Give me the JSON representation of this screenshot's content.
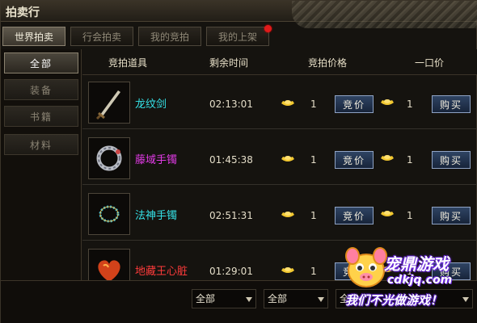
{
  "window": {
    "title": "拍卖行"
  },
  "tabs": [
    {
      "label": "世界拍卖",
      "active": true
    },
    {
      "label": "行会拍卖",
      "active": false
    },
    {
      "label": "我的竞拍",
      "active": false
    },
    {
      "label": "我的上架",
      "active": false,
      "notification": true
    }
  ],
  "categories": [
    {
      "label": "全部",
      "active": true
    },
    {
      "label": "装备",
      "active": false
    },
    {
      "label": "书籍",
      "active": false
    },
    {
      "label": "材料",
      "active": false
    }
  ],
  "table": {
    "headers": {
      "item": "竞拍道具",
      "time": "剩余时间",
      "bid_price": "竞拍价格",
      "buyout": "一口价"
    },
    "rows": [
      {
        "name": "龙纹剑",
        "name_color": "#35e3e8",
        "icon": "sword-icon",
        "time": "02:13:01",
        "bid": "1",
        "bid_button": "竞价",
        "buyout": "1",
        "buy_button": "购买"
      },
      {
        "name": "藤域手镯",
        "name_color": "#e23be6",
        "icon": "bracelet-icon",
        "time": "01:45:38",
        "bid": "1",
        "bid_button": "竞价",
        "buyout": "1",
        "buy_button": "购买"
      },
      {
        "name": "法神手镯",
        "name_color": "#35e3e8",
        "icon": "bead-bracelet-icon",
        "time": "02:51:31",
        "bid": "1",
        "bid_button": "竞价",
        "buyout": "1",
        "buy_button": "购买"
      },
      {
        "name": "地藏王心脏",
        "name_color": "#ff3b3b",
        "icon": "heart-icon",
        "time": "01:29:01",
        "bid": "1",
        "bid_button": "竞价",
        "buyout": "1",
        "buy_button": "购买"
      }
    ]
  },
  "filters": {
    "filter1": "全部",
    "filter2": "全部",
    "filter3": "全"
  },
  "watermark": {
    "brand": "宠鼎游戏",
    "url": "cdkjq.com",
    "slogan": "我们不光做游戏！"
  }
}
